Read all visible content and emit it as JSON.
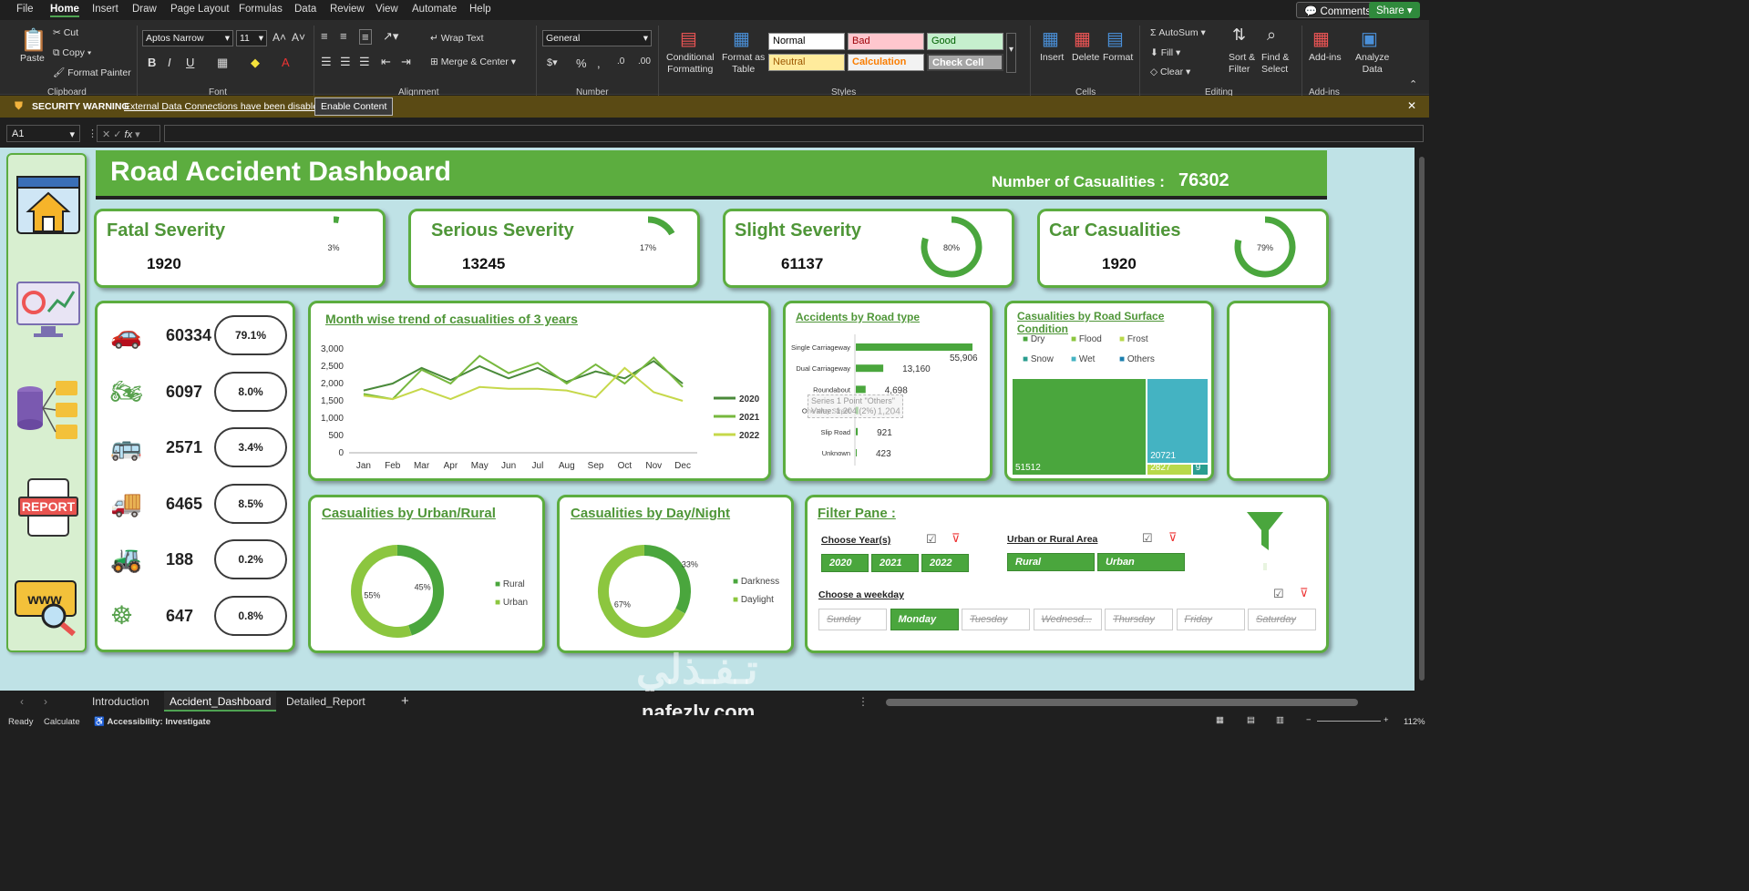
{
  "menu": {
    "items": [
      "File",
      "Home",
      "Insert",
      "Draw",
      "Page Layout",
      "Formulas",
      "Data",
      "Review",
      "View",
      "Automate",
      "Help"
    ],
    "active": "Home",
    "comments": "Comments",
    "share": "Share"
  },
  "ribbon": {
    "clipboard": {
      "paste": "Paste",
      "cut": "Cut",
      "copy": "Copy",
      "format_painter": "Format Painter",
      "group": "Clipboard"
    },
    "font": {
      "name": "Aptos Narrow",
      "size": "11",
      "group": "Font"
    },
    "alignment": {
      "wrap": "Wrap Text",
      "merge": "Merge & Center",
      "group": "Alignment"
    },
    "number": {
      "format": "General",
      "group": "Number"
    },
    "styles": {
      "conditional": "Conditional\nFormatting",
      "format_table": "Format as\nTable",
      "normal": "Normal",
      "bad": "Bad",
      "good": "Good",
      "neutral": "Neutral",
      "calculation": "Calculation",
      "check_cell": "Check Cell",
      "group": "Styles"
    },
    "cells": {
      "insert": "Insert",
      "delete": "Delete",
      "format": "Format",
      "group": "Cells"
    },
    "editing": {
      "autosum": "AutoSum",
      "fill": "Fill",
      "clear": "Clear",
      "sort": "Sort &\nFilter",
      "find": "Find &\nSelect",
      "group": "Editing"
    },
    "addins": {
      "addins": "Add-ins",
      "analyze": "Analyze\nData",
      "group": "Add-ins"
    }
  },
  "security": {
    "label": "SECURITY WARNING",
    "message": "External Data Connections have been disabled",
    "button": "Enable Content"
  },
  "formula": {
    "namebox": "A1",
    "fx": "fx",
    "value": ""
  },
  "dashboard": {
    "title": "Road Accident Dashboard",
    "casualties_label": "Number of Casualities :",
    "casualties_value": "76302",
    "kpis": [
      {
        "title": "Fatal Severity",
        "value": "1920",
        "pct": "3%",
        "fraction": 0.03
      },
      {
        "title": "Serious Severity",
        "value": "13245",
        "pct": "17%",
        "fraction": 0.17
      },
      {
        "title": "Slight Severity",
        "value": "61137",
        "pct": "80%",
        "fraction": 0.8
      },
      {
        "title": "Car Casualities",
        "value": "1920",
        "pct": "79%",
        "fraction": 0.79
      }
    ],
    "vehicles": [
      {
        "icon": "car-icon",
        "value": "60334",
        "pct": "79.1%"
      },
      {
        "icon": "motorcycle-icon",
        "value": "6097",
        "pct": "8.0%"
      },
      {
        "icon": "bus-icon",
        "value": "2571",
        "pct": "3.4%"
      },
      {
        "icon": "truck-icon",
        "value": "6465",
        "pct": "8.5%"
      },
      {
        "icon": "tractor-icon",
        "value": "188",
        "pct": "0.2%"
      },
      {
        "icon": "steering-wheel-icon",
        "value": "647",
        "pct": "0.8%"
      }
    ],
    "urban_title": "Casualities by Urban/Rural",
    "daynight_title": "Casualities by Day/Night",
    "filter": {
      "title": "Filter Pane :",
      "year_label": "Choose Year(s)",
      "years": [
        "2020",
        "2021",
        "2022"
      ],
      "area_label": "Urban  or  Rural  Area",
      "areas": [
        "Rural",
        "Urban"
      ],
      "weekday_label": "Choose a weekday",
      "weekdays": [
        "Sunday",
        "Monday",
        "Tuesday",
        "Wednesd...",
        "Thursday",
        "Friday",
        "Saturday"
      ],
      "selected_weekday": "Monday"
    },
    "sidebar_icons": [
      "home-browser-icon",
      "analytics-monitor-icon",
      "database-folders-icon",
      "report-icon",
      "www-search-icon"
    ],
    "report_label": "REPORT",
    "www_label": "www",
    "tooltip": [
      "Series 1 Point \"Others\"",
      "Value: 1,204 (2%)"
    ]
  },
  "chart_data": [
    {
      "type": "line",
      "title": "Month wise trend of casualities of 3 years",
      "x": [
        "Jan",
        "Feb",
        "Mar",
        "Apr",
        "May",
        "Jun",
        "Jul",
        "Aug",
        "Sep",
        "Oct",
        "Nov",
        "Dec"
      ],
      "series": [
        {
          "name": "2020",
          "color": "#4a8a3a",
          "values": [
            1800,
            2000,
            2450,
            2100,
            2500,
            2150,
            2450,
            2050,
            2350,
            2150,
            2650,
            2000
          ]
        },
        {
          "name": "2021",
          "color": "#77b83e",
          "values": [
            1700,
            1550,
            2400,
            2000,
            2800,
            2300,
            2600,
            2000,
            2550,
            2000,
            2750,
            1900
          ]
        },
        {
          "name": "2022",
          "color": "#c6d84a",
          "values": [
            1650,
            1550,
            1850,
            1550,
            1900,
            1850,
            1850,
            1800,
            1600,
            2450,
            1750,
            1500
          ]
        }
      ],
      "ylim": [
        0,
        3000
      ],
      "yticks": [
        "0",
        "500",
        "1,000",
        "1,500",
        "2,000",
        "2,500",
        "3,000"
      ]
    },
    {
      "type": "bar",
      "title": "Accidents by Road type",
      "categories": [
        "Single Carriageway",
        "Dual Carriageway",
        "Roundabout",
        "One Way Street",
        "Slip Road",
        "Unknown"
      ],
      "values": [
        55906,
        13160,
        4698,
        1204,
        921,
        423
      ],
      "labels": [
        "55,906",
        "13,160",
        "4,698",
        "1,204",
        "921",
        "423"
      ]
    },
    {
      "type": "treemap",
      "title": "Casualities by Road Surface Condition",
      "legend": [
        "Dry",
        "Flood",
        "Frost",
        "Snow",
        "Wet",
        "Others"
      ],
      "colors": [
        "#4aa63d",
        "#8cc63f",
        "#b8d94a",
        "#2a9d8f",
        "#44b3c2",
        "#1b7fae"
      ],
      "values": [
        51512,
        20721,
        2827,
        9
      ],
      "labels": [
        "51512",
        "20721",
        "2827",
        "9"
      ]
    },
    {
      "type": "pie",
      "title": "Casualities by Urban/Rural",
      "legend": [
        "Rural",
        "Urban"
      ],
      "values": [
        45,
        55
      ],
      "labels": [
        "45%",
        "55%"
      ],
      "colors": [
        "#4aa63d",
        "#8cc63f"
      ]
    },
    {
      "type": "pie",
      "title": "Casualities by Day/Night",
      "legend": [
        "Darkness",
        "Daylight"
      ],
      "values": [
        33,
        67
      ],
      "labels": [
        "33%",
        "67%"
      ],
      "colors": [
        "#4aa63d",
        "#8cc63f"
      ]
    }
  ],
  "tabs": {
    "items": [
      "Introduction",
      "Accident_Dashboard",
      "Detailed_Report"
    ],
    "active": "Accident_Dashboard"
  },
  "status": {
    "ready": "Ready",
    "calculate": "Calculate",
    "accessibility": "Accessibility: Investigate",
    "zoom": "112%"
  },
  "watermark": "nafezly.com"
}
